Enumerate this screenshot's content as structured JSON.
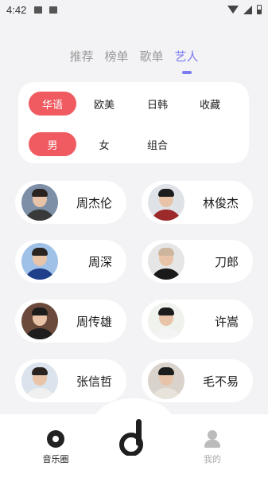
{
  "status_bar": {
    "time": "4:42"
  },
  "tabs": [
    {
      "label": "推荐",
      "active": false
    },
    {
      "label": "榜单",
      "active": false
    },
    {
      "label": "歌单",
      "active": false
    },
    {
      "label": "艺人",
      "active": true
    }
  ],
  "filters": {
    "region": [
      "华语",
      "欧美",
      "日韩",
      "收藏"
    ],
    "region_selected": "华语",
    "type": [
      "男",
      "女",
      "组合"
    ],
    "type_selected": "男"
  },
  "artists": [
    {
      "name": "周杰伦",
      "colors": {
        "bg": "#7d8fa6",
        "body": "#3a3a3a",
        "hair": "#2a2420"
      }
    },
    {
      "name": "林俊杰",
      "colors": {
        "bg": "#dfe3e8",
        "body": "#9c2a2a",
        "hair": "#1c1c1c"
      }
    },
    {
      "name": "周深",
      "colors": {
        "bg": "#9fc1e8",
        "body": "#1f3f8a",
        "hair": "#2a2420"
      }
    },
    {
      "name": "刀郎",
      "colors": {
        "bg": "#e6e6e6",
        "body": "#1a1a1a",
        "hair": "#cdb49c"
      }
    },
    {
      "name": "周传雄",
      "colors": {
        "bg": "#6b4a3c",
        "body": "#1e1e1e",
        "hair": "#1c1c1c"
      }
    },
    {
      "name": "许嵩",
      "colors": {
        "bg": "#f0f2ee",
        "body": "#f4f4f4",
        "hair": "#1c1c1c"
      }
    },
    {
      "name": "张信哲",
      "colors": {
        "bg": "#dbe4ec",
        "body": "#f0f0f0",
        "hair": "#2a2420"
      }
    },
    {
      "name": "毛不易",
      "colors": {
        "bg": "#d9d3cb",
        "body": "#e8e3da",
        "hair": "#1c1c1c"
      }
    }
  ],
  "bottom_nav": {
    "left_label": "音乐圈",
    "right_label": "我的",
    "left_icon": "disc-icon",
    "center_icon": "note-logo-icon",
    "right_icon": "user-icon"
  },
  "colors": {
    "accent_active_chip": "#ef5b61",
    "accent_tab": "#7b7bf0",
    "background": "#f3f3f5"
  }
}
